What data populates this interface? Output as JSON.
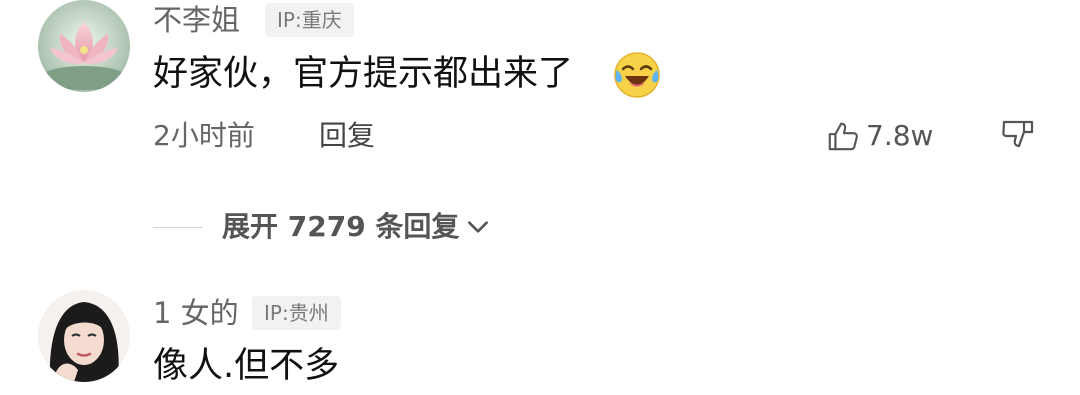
{
  "comments": [
    {
      "username": "不李姐",
      "ip_label": "IP:重庆",
      "text": "好家伙，官方提示都出来了",
      "emoji_icon": "crying-laughing-emoji-icon",
      "time": "2小时前",
      "reply_label": "回复",
      "like_count": "7.8w",
      "expand_label": "展开 7279 条回复"
    },
    {
      "username": "1 女的",
      "ip_label": "IP:贵州",
      "text": "像人.但不多"
    }
  ],
  "colors": {
    "secondary_text": "#666666",
    "badge_bg": "#f2f2f2",
    "primary_text": "#111111"
  }
}
